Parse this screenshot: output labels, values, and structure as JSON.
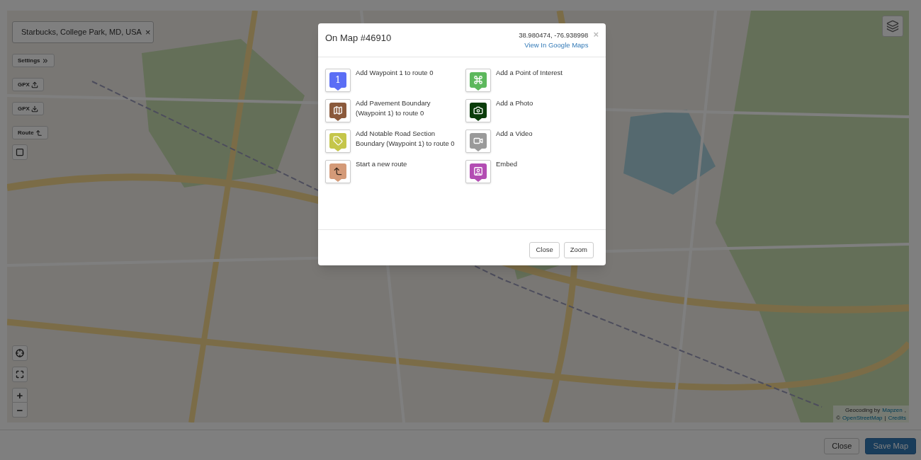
{
  "search": {
    "value": "Starbucks, College Park, MD, USA",
    "clear": "×"
  },
  "toolbar": [
    {
      "kind": "settings",
      "label": "Settings"
    },
    {
      "kind": "gpx-upload",
      "label": "GPX"
    },
    {
      "kind": "gpx-download",
      "label": "GPX"
    },
    {
      "kind": "route",
      "label": "Route"
    },
    {
      "kind": "select"
    }
  ],
  "zoom": {
    "in": "+",
    "out": "−"
  },
  "attribution": [
    [
      {
        "kind": "text",
        "text": "Geocoding by"
      },
      {
        "kind": "link",
        "text": "Mapzen"
      },
      {
        "kind": "text",
        "text": ","
      }
    ],
    [
      {
        "kind": "text",
        "text": "©"
      },
      {
        "kind": "link",
        "text": "OpenStreetMap"
      },
      {
        "kind": "text",
        "text": "|"
      },
      {
        "kind": "link",
        "text": "Credits"
      }
    ]
  ],
  "modal": {
    "title": "On Map #46910",
    "coordinates": "38.980474, -76.938998",
    "google_link": "View In Google Maps",
    "close": "×",
    "columns": [
      [
        {
          "kind": "waypoint",
          "badge": "1",
          "color": "#5b6ef5",
          "label": "Add Waypoint 1 to route 0"
        },
        {
          "kind": "pavement",
          "color": "#8b5a3c",
          "label": "Add Pavement Boundary (Waypoint 1) to route 0"
        },
        {
          "kind": "road",
          "color": "#c5c64a",
          "label": "Add Notable Road Section Boundary (Waypoint 1) to route 0"
        },
        {
          "kind": "route",
          "color": "#d49a78",
          "label": "Start a new route"
        }
      ],
      [
        {
          "kind": "poi",
          "color": "#5cb85c",
          "label": "Add a Point of Interest"
        },
        {
          "color": "#0b3d0b",
          "label": "Add a Photo"
        },
        {
          "kind": "video",
          "color": "#9a9a9a",
          "label": "Add a Video"
        },
        {
          "kind": "embed",
          "color": "#b34db3",
          "label": "Embed"
        }
      ]
    ],
    "buttons": [
      "Close",
      "Zoom"
    ]
  },
  "footer": {
    "buttons": [
      {
        "kind": "default",
        "label": "Close"
      },
      {
        "kind": "primary",
        "label": "Save Map"
      }
    ]
  }
}
